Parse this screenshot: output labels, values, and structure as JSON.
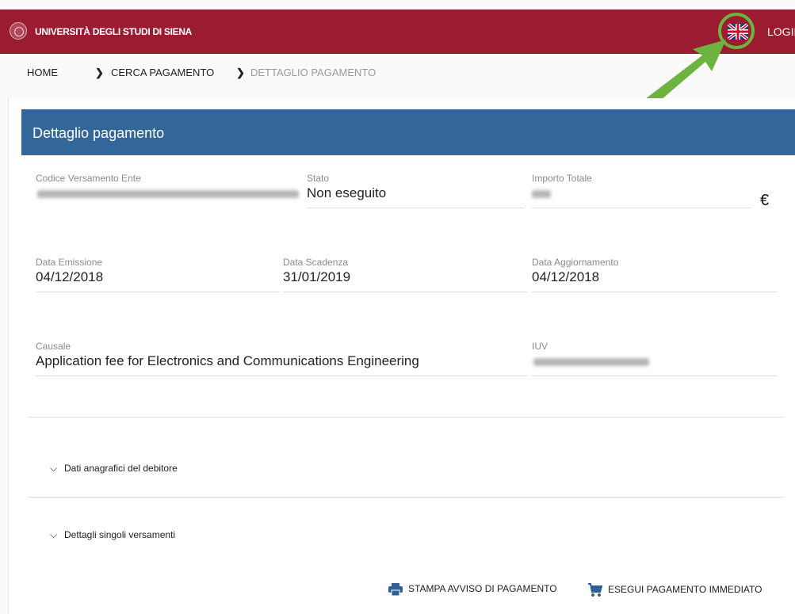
{
  "header": {
    "brand": "UNIVERSITÀ DEGLI STUDI DI SIENA",
    "login": "LOGIN",
    "language_icon": "uk-flag-icon",
    "highlight_color": "#6db33f",
    "bar_color": "#9b1b30"
  },
  "breadcrumb": {
    "items": [
      "HOME",
      "CERCA PAGAMENTO",
      "DETTAGLIO PAGAMENTO"
    ]
  },
  "card": {
    "title": "Dettaglio pagamento",
    "header_color": "#336699"
  },
  "fields": {
    "codice": {
      "label": "Codice Versamento Ente",
      "value": ""
    },
    "stato": {
      "label": "Stato",
      "value": "Non eseguito"
    },
    "importo": {
      "label": "Importo Totale",
      "value": "",
      "currency": "€"
    },
    "emissione": {
      "label": "Data Emissione",
      "value": "04/12/2018"
    },
    "scadenza": {
      "label": "Data Scadenza",
      "value": "31/01/2019"
    },
    "aggiornamento": {
      "label": "Data Aggiornamento",
      "value": "04/12/2018"
    },
    "causale": {
      "label": "Causale",
      "value": "Application fee for Electronics and Communications Engineering"
    },
    "iuv": {
      "label": "IUV",
      "value": ""
    }
  },
  "accordions": {
    "debitore": "Dati anagrafici del debitore",
    "versamenti": "Dettagli singoli versamenti"
  },
  "actions": {
    "stampa": "STAMPA AVVISO DI PAGAMENTO",
    "esegui": "ESEGUI PAGAMENTO IMMEDIATO"
  }
}
